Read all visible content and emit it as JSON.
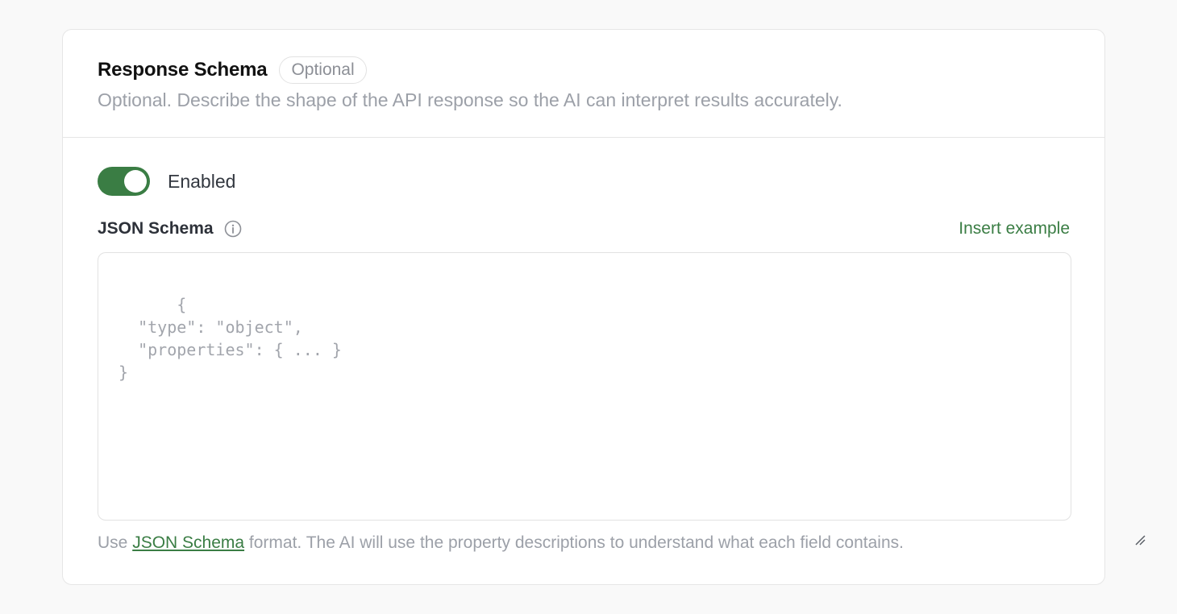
{
  "header": {
    "title": "Response Schema",
    "badge": "Optional",
    "description": "Optional. Describe the shape of the API response so the AI can interpret results accurately."
  },
  "toggle": {
    "label": "Enabled",
    "on": true,
    "color": "#3a7d44"
  },
  "schema_field": {
    "label": "JSON Schema",
    "info_icon": "info-icon",
    "insert_example_label": "Insert example",
    "placeholder": "{\n  \"type\": \"object\",\n  \"properties\": { ... }\n}"
  },
  "helper": {
    "prefix": "Use ",
    "link": "JSON Schema",
    "suffix": " format. The AI will use the property descriptions to understand what each field contains."
  },
  "colors": {
    "accent": "#3a7d44",
    "muted_text": "#9ca0a8",
    "border": "#e6e6e6"
  }
}
